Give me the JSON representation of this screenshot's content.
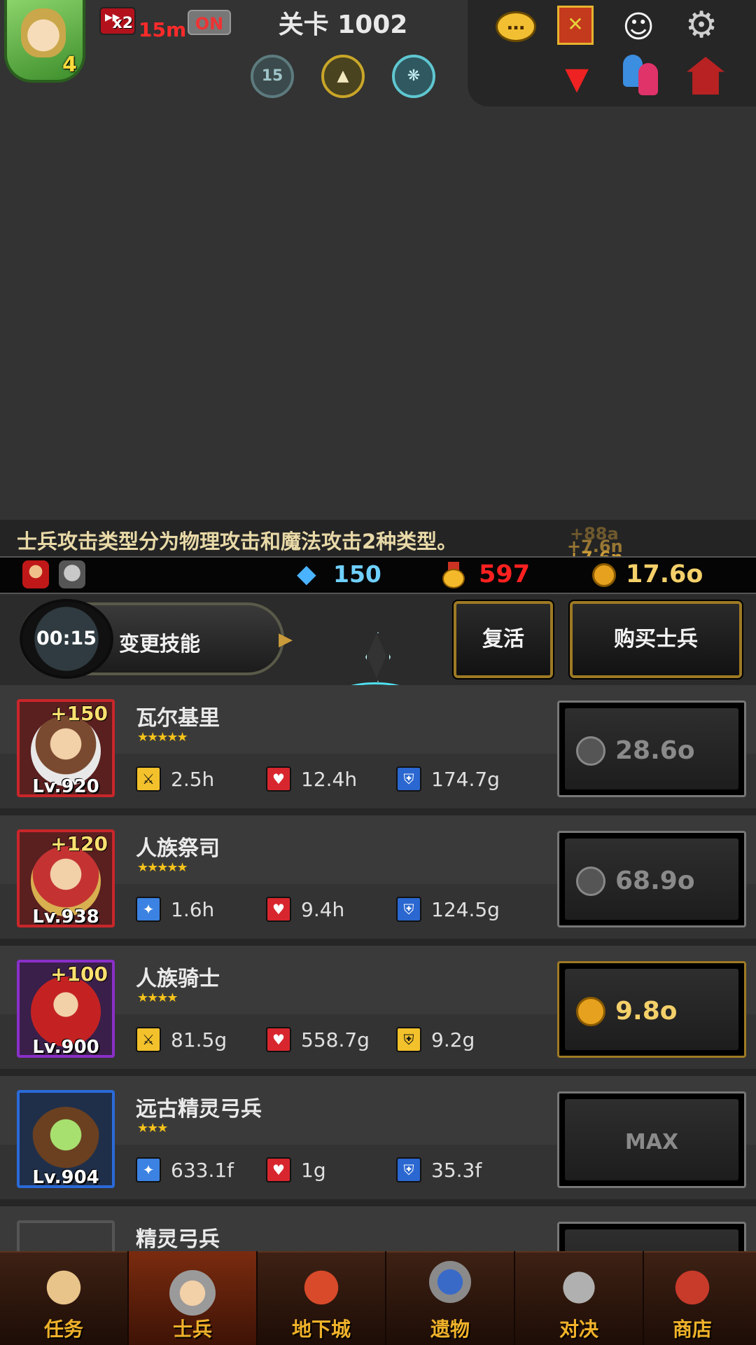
{
  "hud": {
    "avatar_level": "4",
    "speed_multiplier": "x2",
    "speed_time": "15m",
    "auto_toggle": "ON",
    "stage_title": "关卡 1002",
    "buff_badge_15": "15",
    "icons": [
      "chat-icon",
      "guild-icon",
      "angel-icon",
      "settings-icon",
      "down-arrow-icon",
      "friends-icon",
      "mail-icon"
    ]
  },
  "tip": {
    "text": "士兵攻击类型分为物理攻击和魔法攻击2种类型。",
    "float_1": "+88a",
    "float_2": "+7.6n",
    "float_3": "+7.6n"
  },
  "currency": {
    "gems": "150",
    "medals": "597",
    "gold": "17.6o",
    "colors": {
      "gems": "#6fd0ff",
      "medals": "#ff2020",
      "gold": "#f4d06a"
    }
  },
  "actions": {
    "skill_timer": "00:15",
    "skill_label": "变更技能",
    "revive_label": "复活",
    "buy_soldier_label": "购买士兵"
  },
  "soldiers": [
    {
      "name": "瓦尔基里",
      "stars": "★★★★★",
      "plus": "+150",
      "level": "Lv.920",
      "stat1_icon": "sword-icon",
      "stat1": "2.5h",
      "stat2_icon": "heart-icon",
      "stat2": "12.4h",
      "stat3_icon": "shield-icon",
      "stat3": "174.7g",
      "cost": "28.6o",
      "frame_color": "#c8262a"
    },
    {
      "name": "人族祭司",
      "stars": "★★★★★",
      "plus": "+120",
      "level": "Lv.938",
      "stat1_icon": "magic-wand-icon",
      "stat1": "1.6h",
      "stat2_icon": "heart-icon",
      "stat2": "9.4h",
      "stat3_icon": "shield-icon",
      "stat3": "124.5g",
      "cost": "68.9o",
      "frame_color": "#c8262a"
    },
    {
      "name": "人族骑士",
      "stars": "★★★★",
      "plus": "+100",
      "level": "Lv.900",
      "stat1_icon": "sword-icon",
      "stat1": "81.5g",
      "stat2_icon": "heart-icon",
      "stat2": "558.7g",
      "stat3_icon": "shield-icon",
      "stat3": "9.2g",
      "cost": "9.8o",
      "frame_color": "#8a2fc8"
    },
    {
      "name": "远古精灵弓兵",
      "stars": "★★★",
      "plus": "",
      "level": "Lv.904",
      "stat1_icon": "magic-wand-icon",
      "stat1": "633.1f",
      "stat2_icon": "heart-icon",
      "stat2": "1g",
      "stat3_icon": "shield-icon",
      "stat3": "35.3f",
      "cost": "MAX",
      "frame_color": "#2a6ad8"
    },
    {
      "name": "精灵弓兵"
    }
  ],
  "nav": {
    "tabs": [
      "任务",
      "士兵",
      "地下城",
      "遗物",
      "对决",
      "商店"
    ],
    "active": "士兵"
  }
}
